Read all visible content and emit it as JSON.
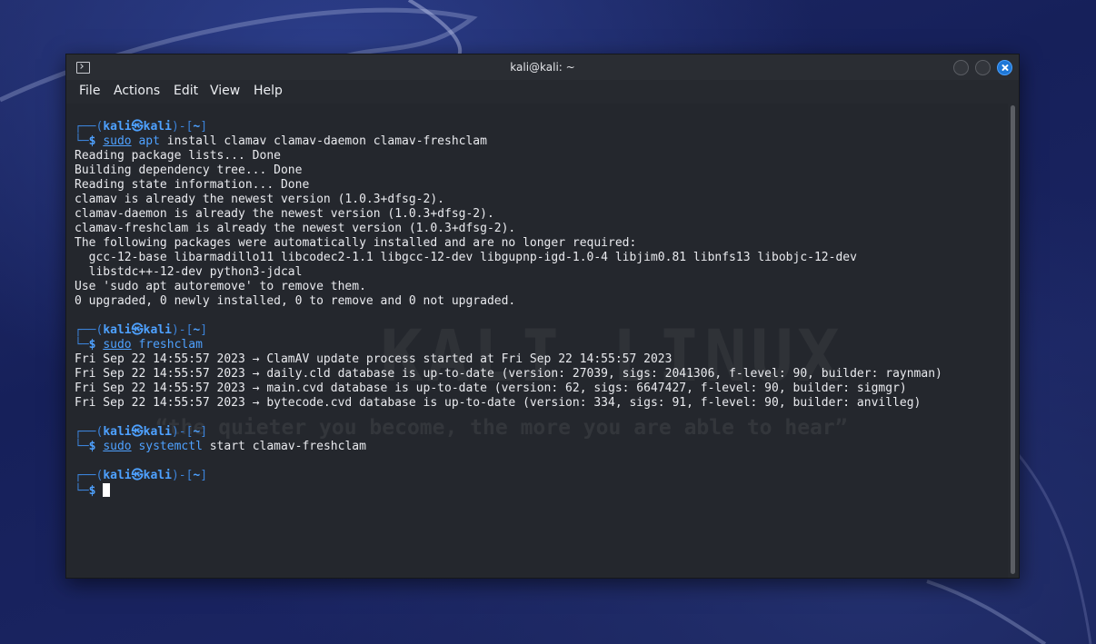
{
  "window": {
    "title": "kali@kali: ~"
  },
  "menu": [
    "File",
    "Actions",
    "Edit",
    "View",
    "Help"
  ],
  "watermark": {
    "text": "KALI LINUX",
    "tagline": "“the quieter you become, the more you are able to hear”"
  },
  "prompt": {
    "user": "kali",
    "at": "㉿",
    "host": "kali",
    "dir": "~"
  },
  "blocks": [
    {
      "sudo": "sudo",
      "cmd": "apt",
      "args": " install clamav clamav-daemon clamav-freshclam",
      "output": [
        "Reading package lists... Done",
        "Building dependency tree... Done",
        "Reading state information... Done",
        "clamav is already the newest version (1.0.3+dfsg-2).",
        "clamav-daemon is already the newest version (1.0.3+dfsg-2).",
        "clamav-freshclam is already the newest version (1.0.3+dfsg-2).",
        "The following packages were automatically installed and are no longer required:",
        "  gcc-12-base libarmadillo11 libcodec2-1.1 libgcc-12-dev libgupnp-igd-1.0-4 libjim0.81 libnfs13 libobjc-12-dev",
        "  libstdc++-12-dev python3-jdcal",
        "Use 'sudo apt autoremove' to remove them.",
        "0 upgraded, 0 newly installed, 0 to remove and 0 not upgraded."
      ]
    },
    {
      "sudo": "sudo",
      "cmd": "freshclam",
      "args": "",
      "output": [
        "Fri Sep 22 14:55:57 2023 → ClamAV update process started at Fri Sep 22 14:55:57 2023",
        "Fri Sep 22 14:55:57 2023 → daily.cld database is up-to-date (version: 27039, sigs: 2041306, f-level: 90, builder: raynman)",
        "Fri Sep 22 14:55:57 2023 → main.cvd database is up-to-date (version: 62, sigs: 6647427, f-level: 90, builder: sigmgr)",
        "Fri Sep 22 14:55:57 2023 → bytecode.cvd database is up-to-date (version: 334, sigs: 91, f-level: 90, builder: anvilleg)"
      ]
    },
    {
      "sudo": "sudo",
      "cmd": "systemctl",
      "args": " start clamav-freshclam",
      "output": []
    },
    {
      "sudo": "",
      "cmd": "",
      "args": "",
      "output": [],
      "active": true
    }
  ],
  "colors": {
    "accent": "#4ea1ff",
    "frame": "#3b82d8",
    "close": "#1e77d6"
  }
}
